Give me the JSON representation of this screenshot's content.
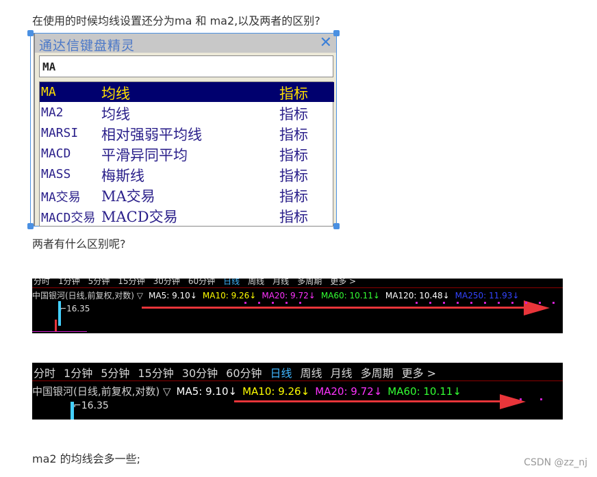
{
  "question": "在使用的时候均线设置还分为ma 和 ma2,以及两者的区别?",
  "popup": {
    "title": "通达信键盘精灵",
    "close": "✕",
    "input": "MA",
    "items": [
      {
        "code": "MA",
        "name": "均线",
        "type": "指标"
      },
      {
        "code": "MA2",
        "name": "均线",
        "type": "指标"
      },
      {
        "code": "MARSI",
        "name": "相对强弱平均线",
        "type": "指标"
      },
      {
        "code": "MACD",
        "name": "平滑异同平均",
        "type": "指标"
      },
      {
        "code": "MASS",
        "name": "梅斯线",
        "type": "指标"
      },
      {
        "code": "MA交易",
        "name": "MA交易",
        "type": "指标"
      },
      {
        "code": "MACD交易",
        "name": "MACD交易",
        "type": "指标"
      }
    ]
  },
  "question2": "两者有什么区别呢?",
  "chart1": {
    "tabs": [
      "分时",
      "1分钟",
      "5分钟",
      "15分钟",
      "30分钟",
      "60分钟",
      "日线",
      "周线",
      "月线",
      "多周期",
      "更多 >"
    ],
    "active_tab": "日线",
    "stock": "中国银河(日线,前复权,对数) ▽",
    "ma": [
      {
        "label": "MA5: 9.10↓",
        "color": "#ffffff"
      },
      {
        "label": "MA10: 9.26↓",
        "color": "#ffff00"
      },
      {
        "label": "MA20: 9.72↓",
        "color": "#ff33ff"
      },
      {
        "label": "MA60: 10.11↓",
        "color": "#33ff33"
      },
      {
        "label": "MA120: 10.48↓",
        "color": "#ffffff"
      },
      {
        "label": "MA250: 11.93↓",
        "color": "#3344ff"
      }
    ],
    "price": "16.35"
  },
  "chart2": {
    "tabs": [
      "分时",
      "1分钟",
      "5分钟",
      "15分钟",
      "30分钟",
      "60分钟",
      "日线",
      "周线",
      "月线",
      "多周期",
      "更多 >"
    ],
    "active_tab": "日线",
    "stock": "中国银河(日线,前复权,对数) ▽",
    "ma": [
      {
        "label": "MA5: 9.10↓",
        "color": "#ffffff"
      },
      {
        "label": "MA10: 9.26↓",
        "color": "#ffff00"
      },
      {
        "label": "MA20: 9.72↓",
        "color": "#ff33ff"
      },
      {
        "label": "MA60: 10.11↓",
        "color": "#33ff33"
      }
    ],
    "price": "16.35"
  },
  "conclusion": "ma2 的均线会多一些;",
  "watermark": "CSDN @zz_nj"
}
